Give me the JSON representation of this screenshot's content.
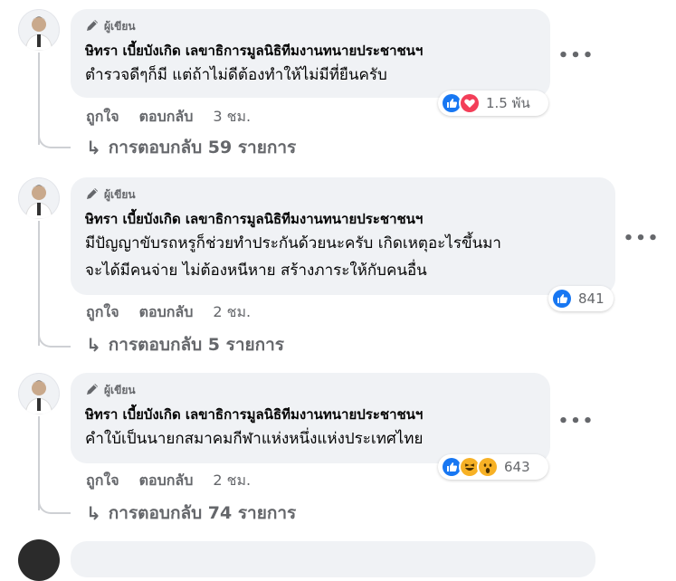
{
  "labels": {
    "author_tag": "ผู้เขียน",
    "like": "ถูกใจ",
    "reply": "ตอบกลับ",
    "more": "•••",
    "reply_arrow": "↳"
  },
  "comments": [
    {
      "author": "ษิทรา เบี้ยบังเกิด เลขาธิการมูลนิธิทีมงานทนายประชาชนฯ",
      "lines": [
        "ตำรวจดีๆก็มี แต่ถ้าไม่ดีต้องทำให้ไม่มีที่ยืนครับ"
      ],
      "reaction_count": "1.5 พัน",
      "reaction_icons": [
        "like-icon",
        "love-icon"
      ],
      "time": "3 ชม.",
      "replies": "การตอบกลับ 59 รายการ"
    },
    {
      "author": "ษิทรา เบี้ยบังเกิด เลขาธิการมูลนิธิทีมงานทนายประชาชนฯ",
      "lines": [
        "มีปัญญาขับรถหรูก็ช่วยทำประกันด้วยนะครับ เกิดเหตุอะไรขึ้นมา",
        "จะได้มีคนจ่าย ไม่ต้องหนีหาย สร้างภาระให้กับคนอื่น"
      ],
      "reaction_count": "841",
      "reaction_icons": [
        "like-icon"
      ],
      "time": "2 ชม.",
      "replies": "การตอบกลับ 5 รายการ"
    },
    {
      "author": "ษิทรา เบี้ยบังเกิด เลขาธิการมูลนิธิทีมงานทนายประชาชนฯ",
      "lines": [
        "คำใบ้เป็นนายกสมาคมกีฬาแห่งหนึ่งแห่งประเทศไทย"
      ],
      "reaction_count": "643",
      "reaction_icons": [
        "like-icon",
        "haha-icon",
        "wow-icon"
      ],
      "time": "2 ชม.",
      "replies": "การตอบกลับ 74 รายการ"
    }
  ],
  "colors": {
    "bubble": "#f0f2f5",
    "like_blue": "#1877f2",
    "love_red": "#f33e58",
    "emoji_yellow": "#f7b125",
    "secondary_text": "#65676b"
  }
}
